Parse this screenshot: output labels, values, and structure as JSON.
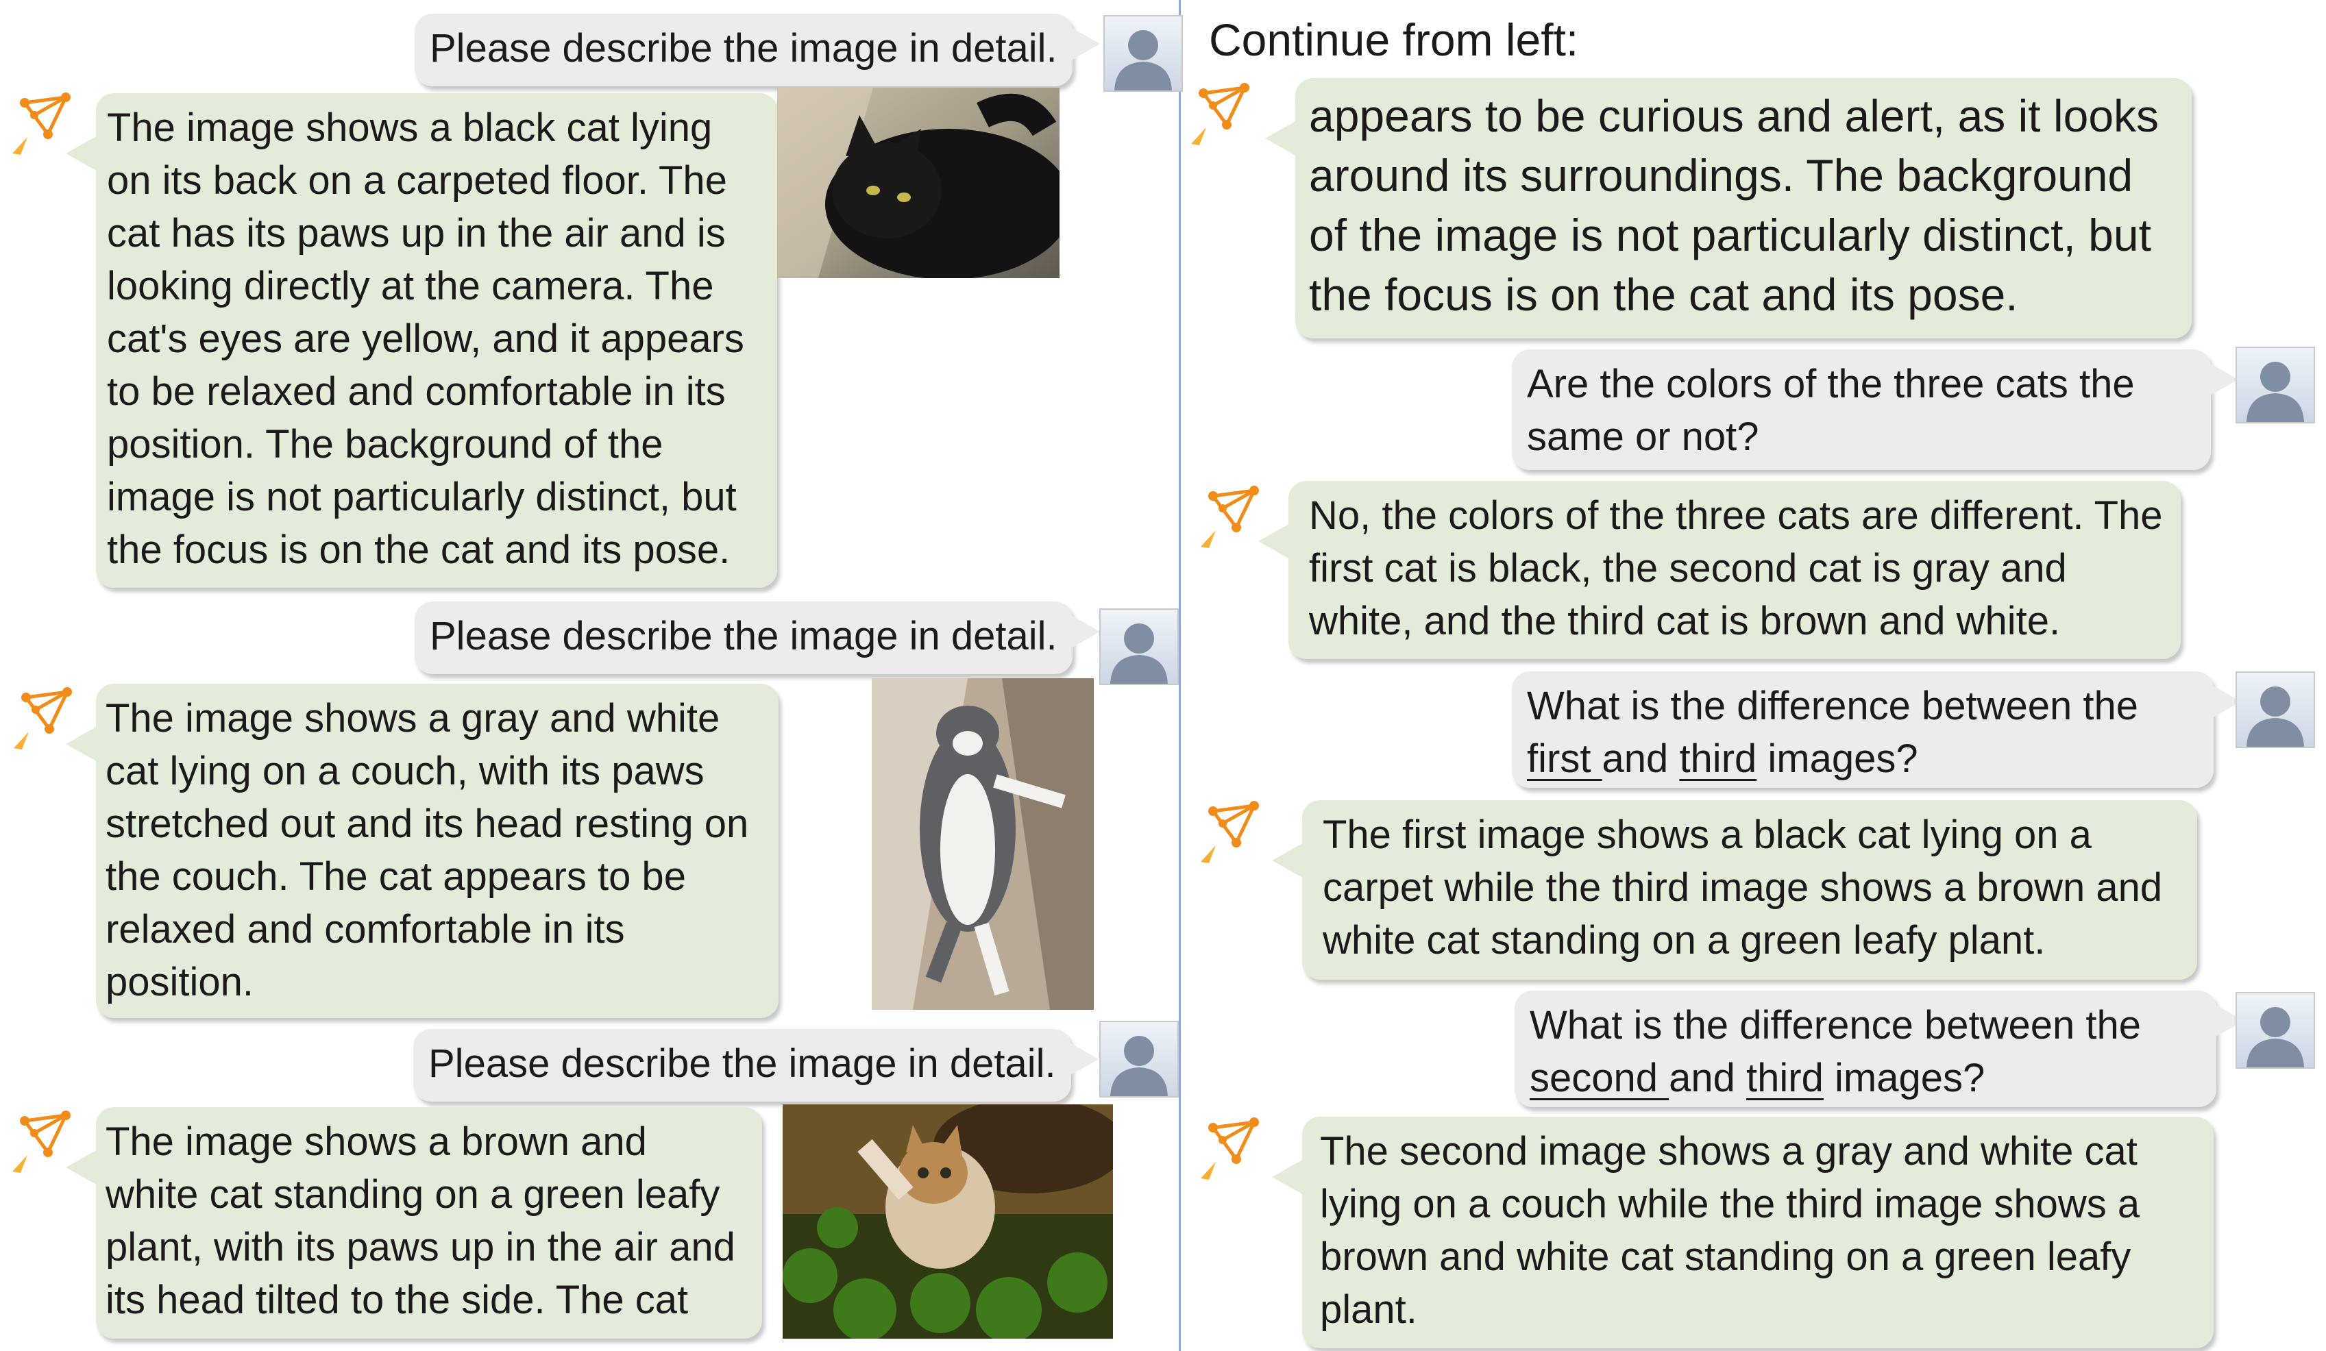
{
  "colors": {
    "user_bubble": "#ececec",
    "bot_bubble": "#e3ecd9",
    "divider": "#8fa6d8",
    "logo": "#f28c18"
  },
  "left": {
    "q1": "Please describe the image in detail.",
    "a1": "The image shows a black cat lying on its back on a carpeted floor. The cat has its paws up in the air and is looking directly at the camera. The cat's eyes are yellow, and it appears to be relaxed and comfortable in its position. The background of the image is not particularly distinct, but the focus is on the cat and its pose.",
    "q2": "Please describe the image in detail.",
    "a2": "The image shows a gray and white cat lying on a couch, with its paws stretched out and its head resting on the couch. The cat appears to be relaxed and comfortable in its position.",
    "q3": "Please describe the image in detail.",
    "a3": "The image shows a brown and white cat standing on a green leafy plant, with its paws up in the air and its head tilted to the side. The cat"
  },
  "right": {
    "heading": "Continue from left:",
    "a3_cont": "appears to be curious and alert, as it looks around its surroundings. The background of the image is not particularly distinct, but the focus is on the cat and its pose.",
    "q4": "Are the colors of the three cats the same or not?",
    "a4": "No, the colors of the three cats are different. The first cat is black, the second cat is gray and white, and the third cat is brown and white.",
    "q5": {
      "pre": "What is the difference between the ",
      "w1": "first ",
      "mid": "and ",
      "w2": "third",
      "post": " images?"
    },
    "a5": "The first image shows a black cat lying on a carpet while the third image shows a brown and white cat standing on a green leafy plant.",
    "q6": {
      "pre": "What is the difference between the ",
      "w1": "second ",
      "mid": "and ",
      "w2": "third",
      "post": " images?"
    },
    "a6": "The second image shows a gray and white cat lying on a couch while the third image shows a brown and white cat standing on a green leafy plant."
  },
  "icons": {
    "user": "user-avatar-icon",
    "bot": "bot-logo-icon"
  },
  "images": [
    "black-cat-photo",
    "gray-white-cat-photo",
    "brown-white-cat-photo"
  ]
}
